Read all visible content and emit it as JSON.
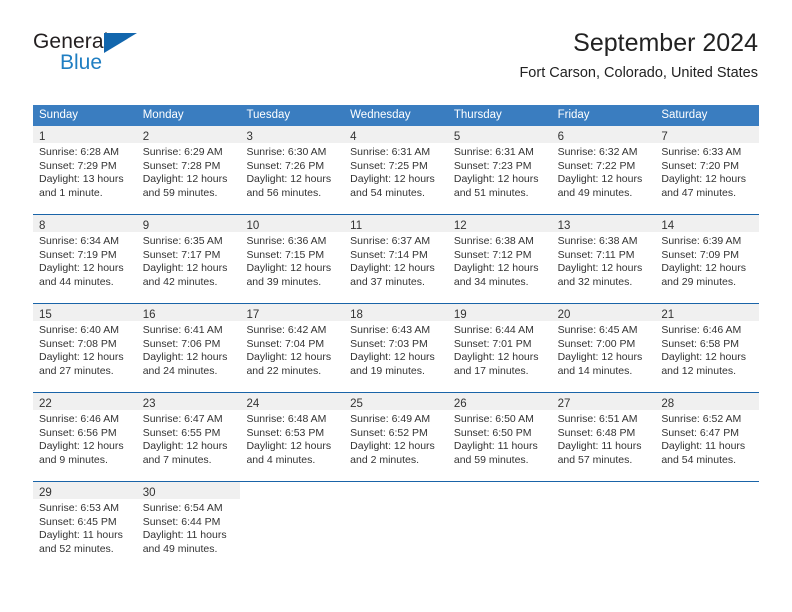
{
  "brand": {
    "name_part1": "General",
    "name_part2": "Blue",
    "triangle_color": "#1266ad",
    "blue_color": "#1f7ec2"
  },
  "header": {
    "title": "September 2024",
    "subtitle": "Fort Carson, Colorado, United States",
    "header_bg": "#3a7dc0",
    "row_divider": "#1a64a8",
    "daynum_bg": "#f0f0f0"
  },
  "weekdays": [
    "Sunday",
    "Monday",
    "Tuesday",
    "Wednesday",
    "Thursday",
    "Friday",
    "Saturday"
  ],
  "labels": {
    "sunrise_prefix": "Sunrise: ",
    "sunset_prefix": "Sunset: ",
    "daylight_prefix": "Daylight: "
  },
  "weeks": [
    [
      {
        "day": "1",
        "sunrise": "Sunrise: 6:28 AM",
        "sunset": "Sunset: 7:29 PM",
        "daylight": "Daylight: 13 hours and 1 minute."
      },
      {
        "day": "2",
        "sunrise": "Sunrise: 6:29 AM",
        "sunset": "Sunset: 7:28 PM",
        "daylight": "Daylight: 12 hours and 59 minutes."
      },
      {
        "day": "3",
        "sunrise": "Sunrise: 6:30 AM",
        "sunset": "Sunset: 7:26 PM",
        "daylight": "Daylight: 12 hours and 56 minutes."
      },
      {
        "day": "4",
        "sunrise": "Sunrise: 6:31 AM",
        "sunset": "Sunset: 7:25 PM",
        "daylight": "Daylight: 12 hours and 54 minutes."
      },
      {
        "day": "5",
        "sunrise": "Sunrise: 6:31 AM",
        "sunset": "Sunset: 7:23 PM",
        "daylight": "Daylight: 12 hours and 51 minutes."
      },
      {
        "day": "6",
        "sunrise": "Sunrise: 6:32 AM",
        "sunset": "Sunset: 7:22 PM",
        "daylight": "Daylight: 12 hours and 49 minutes."
      },
      {
        "day": "7",
        "sunrise": "Sunrise: 6:33 AM",
        "sunset": "Sunset: 7:20 PM",
        "daylight": "Daylight: 12 hours and 47 minutes."
      }
    ],
    [
      {
        "day": "8",
        "sunrise": "Sunrise: 6:34 AM",
        "sunset": "Sunset: 7:19 PM",
        "daylight": "Daylight: 12 hours and 44 minutes."
      },
      {
        "day": "9",
        "sunrise": "Sunrise: 6:35 AM",
        "sunset": "Sunset: 7:17 PM",
        "daylight": "Daylight: 12 hours and 42 minutes."
      },
      {
        "day": "10",
        "sunrise": "Sunrise: 6:36 AM",
        "sunset": "Sunset: 7:15 PM",
        "daylight": "Daylight: 12 hours and 39 minutes."
      },
      {
        "day": "11",
        "sunrise": "Sunrise: 6:37 AM",
        "sunset": "Sunset: 7:14 PM",
        "daylight": "Daylight: 12 hours and 37 minutes."
      },
      {
        "day": "12",
        "sunrise": "Sunrise: 6:38 AM",
        "sunset": "Sunset: 7:12 PM",
        "daylight": "Daylight: 12 hours and 34 minutes."
      },
      {
        "day": "13",
        "sunrise": "Sunrise: 6:38 AM",
        "sunset": "Sunset: 7:11 PM",
        "daylight": "Daylight: 12 hours and 32 minutes."
      },
      {
        "day": "14",
        "sunrise": "Sunrise: 6:39 AM",
        "sunset": "Sunset: 7:09 PM",
        "daylight": "Daylight: 12 hours and 29 minutes."
      }
    ],
    [
      {
        "day": "15",
        "sunrise": "Sunrise: 6:40 AM",
        "sunset": "Sunset: 7:08 PM",
        "daylight": "Daylight: 12 hours and 27 minutes."
      },
      {
        "day": "16",
        "sunrise": "Sunrise: 6:41 AM",
        "sunset": "Sunset: 7:06 PM",
        "daylight": "Daylight: 12 hours and 24 minutes."
      },
      {
        "day": "17",
        "sunrise": "Sunrise: 6:42 AM",
        "sunset": "Sunset: 7:04 PM",
        "daylight": "Daylight: 12 hours and 22 minutes."
      },
      {
        "day": "18",
        "sunrise": "Sunrise: 6:43 AM",
        "sunset": "Sunset: 7:03 PM",
        "daylight": "Daylight: 12 hours and 19 minutes."
      },
      {
        "day": "19",
        "sunrise": "Sunrise: 6:44 AM",
        "sunset": "Sunset: 7:01 PM",
        "daylight": "Daylight: 12 hours and 17 minutes."
      },
      {
        "day": "20",
        "sunrise": "Sunrise: 6:45 AM",
        "sunset": "Sunset: 7:00 PM",
        "daylight": "Daylight: 12 hours and 14 minutes."
      },
      {
        "day": "21",
        "sunrise": "Sunrise: 6:46 AM",
        "sunset": "Sunset: 6:58 PM",
        "daylight": "Daylight: 12 hours and 12 minutes."
      }
    ],
    [
      {
        "day": "22",
        "sunrise": "Sunrise: 6:46 AM",
        "sunset": "Sunset: 6:56 PM",
        "daylight": "Daylight: 12 hours and 9 minutes."
      },
      {
        "day": "23",
        "sunrise": "Sunrise: 6:47 AM",
        "sunset": "Sunset: 6:55 PM",
        "daylight": "Daylight: 12 hours and 7 minutes."
      },
      {
        "day": "24",
        "sunrise": "Sunrise: 6:48 AM",
        "sunset": "Sunset: 6:53 PM",
        "daylight": "Daylight: 12 hours and 4 minutes."
      },
      {
        "day": "25",
        "sunrise": "Sunrise: 6:49 AM",
        "sunset": "Sunset: 6:52 PM",
        "daylight": "Daylight: 12 hours and 2 minutes."
      },
      {
        "day": "26",
        "sunrise": "Sunrise: 6:50 AM",
        "sunset": "Sunset: 6:50 PM",
        "daylight": "Daylight: 11 hours and 59 minutes."
      },
      {
        "day": "27",
        "sunrise": "Sunrise: 6:51 AM",
        "sunset": "Sunset: 6:48 PM",
        "daylight": "Daylight: 11 hours and 57 minutes."
      },
      {
        "day": "28",
        "sunrise": "Sunrise: 6:52 AM",
        "sunset": "Sunset: 6:47 PM",
        "daylight": "Daylight: 11 hours and 54 minutes."
      }
    ],
    [
      {
        "day": "29",
        "sunrise": "Sunrise: 6:53 AM",
        "sunset": "Sunset: 6:45 PM",
        "daylight": "Daylight: 11 hours and 52 minutes."
      },
      {
        "day": "30",
        "sunrise": "Sunrise: 6:54 AM",
        "sunset": "Sunset: 6:44 PM",
        "daylight": "Daylight: 11 hours and 49 minutes."
      },
      {
        "day": "",
        "sunrise": "",
        "sunset": "",
        "daylight": ""
      },
      {
        "day": "",
        "sunrise": "",
        "sunset": "",
        "daylight": ""
      },
      {
        "day": "",
        "sunrise": "",
        "sunset": "",
        "daylight": ""
      },
      {
        "day": "",
        "sunrise": "",
        "sunset": "",
        "daylight": ""
      },
      {
        "day": "",
        "sunrise": "",
        "sunset": "",
        "daylight": ""
      }
    ]
  ]
}
